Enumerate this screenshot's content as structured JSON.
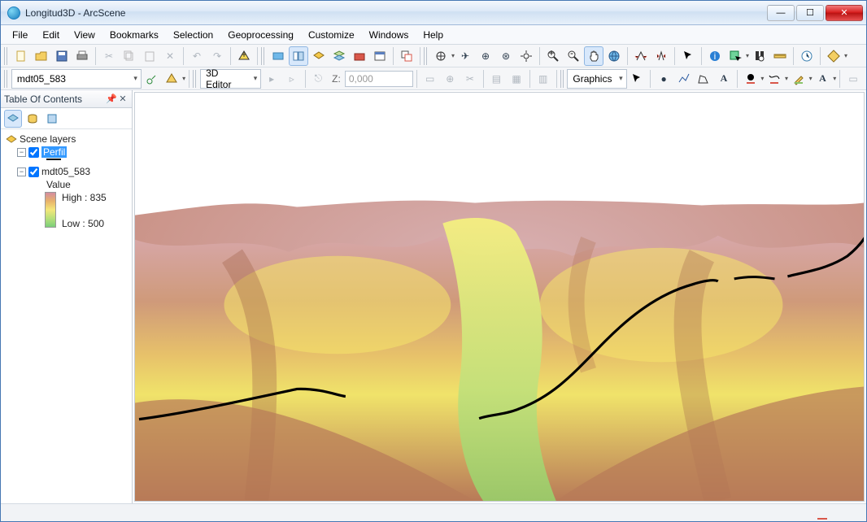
{
  "window": {
    "title": "Longitud3D - ArcScene"
  },
  "menu": [
    "File",
    "Edit",
    "View",
    "Bookmarks",
    "Selection",
    "Geoprocessing",
    "Customize",
    "Windows",
    "Help"
  ],
  "layerCombo": "mdt05_583",
  "editor": {
    "label": "3D Editor",
    "zLabel": "Z:",
    "zValue": "0,000"
  },
  "graphics": {
    "label": "Graphics"
  },
  "toc": {
    "title": "Table Of Contents",
    "root": "Scene layers",
    "layer1": "Perfil",
    "layer2": "mdt05_583",
    "valueLabel": "Value",
    "high": "High : 835",
    "low": "Low : 500"
  },
  "colors": {
    "sky": "#ffffff"
  }
}
